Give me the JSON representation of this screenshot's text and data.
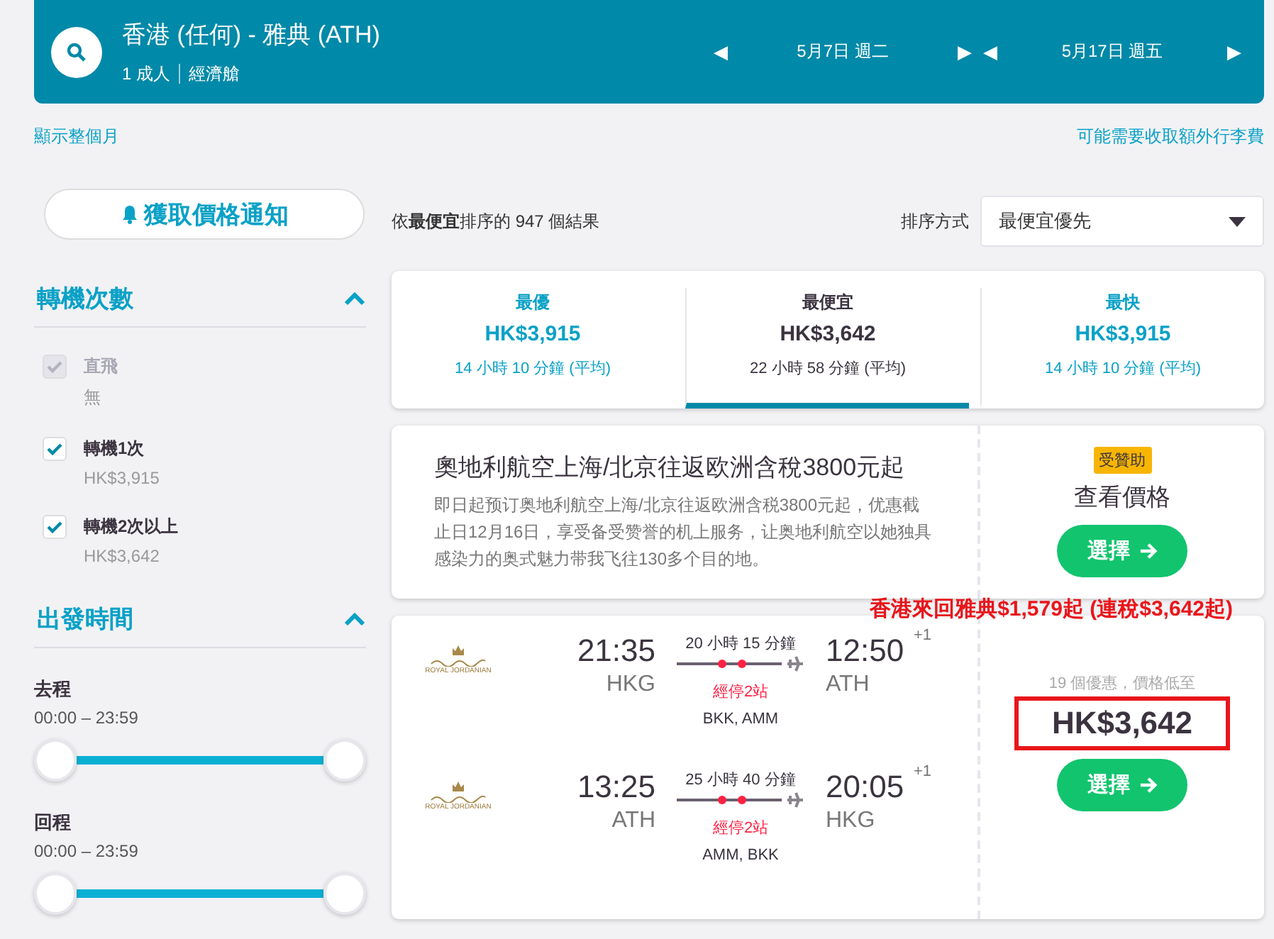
{
  "search_bar": {
    "route": "香港 (任何) - 雅典 (ATH)",
    "passengers": "1 成人",
    "cabin": "經濟艙",
    "dates": [
      {
        "prev": "◀",
        "label": "5月7日 週二",
        "next": "▶"
      },
      {
        "prev": "◀",
        "label": "5月17日 週五",
        "next": "▶"
      }
    ]
  },
  "links": {
    "month": "顯示整個月",
    "fees": "可能需要收取額外行李費"
  },
  "alert_button": "獲取價格通知",
  "filters": {
    "stops": {
      "title": "轉機次數",
      "expanded": true,
      "options": [
        {
          "label": "直飛",
          "sub": "無",
          "checked": true,
          "disabled": true
        },
        {
          "label": "轉機1次",
          "sub": "HK$3,915",
          "checked": true,
          "disabled": false
        },
        {
          "label": "轉機2次以上",
          "sub": "HK$3,642",
          "checked": true,
          "disabled": false
        }
      ]
    },
    "times": {
      "title": "出發時間",
      "expanded": true,
      "ranges": [
        {
          "label": "去程",
          "range": "00:00 – 23:59",
          "level": 1
        },
        {
          "label": "回程",
          "range": "00:00 – 23:59",
          "level": 1
        }
      ]
    }
  },
  "results_summary": "依**最便宜**排序的 947 個結果",
  "sort": {
    "label": "排序方式",
    "value": "最便宜優先"
  },
  "summary_tabs": [
    {
      "title": "最優",
      "price": "HK$3,915",
      "duration": "14 小時 10 分鐘 (平均)",
      "selected": false
    },
    {
      "title": "最便宜",
      "price": "HK$3,642",
      "duration": "22 小時 58 分鐘 (平均)",
      "selected": true
    },
    {
      "title": "最快",
      "price": "HK$3,915",
      "duration": "14 小時 10 分鐘 (平均)",
      "selected": false
    }
  ],
  "ad": {
    "title": "奧地利航空上海/北京往返欧洲含稅3800元起",
    "body": "即日起预订奥地利航空上海/北京往返欧洲含税3800元起，优惠截止日12月16日，享受备受赞誉的机上服务，让奥地利航空以她独具感染力的奥式魅力带我飞往130多个目的地。",
    "badge": "受贊助",
    "cta_text": "查看價格",
    "button": "選擇"
  },
  "annotation": "香港來回雅典$1,579起 (連稅$3,642起)",
  "result": {
    "legs": [
      {
        "airline": "ROYAL JORDANIAN",
        "depart": "21:35",
        "from": "HKG",
        "duration": "20 小時 15 分鐘",
        "stops": "經停2站",
        "via": "BKK, AMM",
        "arrive": "12:50",
        "day_offset": "+1",
        "to": "ATH"
      },
      {
        "airline": "ROYAL JORDANIAN",
        "depart": "13:25",
        "from": "ATH",
        "duration": "25 小時 40 分鐘",
        "stops": "經停2站",
        "via": "AMM, BKK",
        "arrive": "20:05",
        "day_offset": "+1",
        "to": "HKG"
      }
    ],
    "deals": "19 個優惠，價格低至",
    "price": "HK$3,642",
    "button": "選擇"
  }
}
